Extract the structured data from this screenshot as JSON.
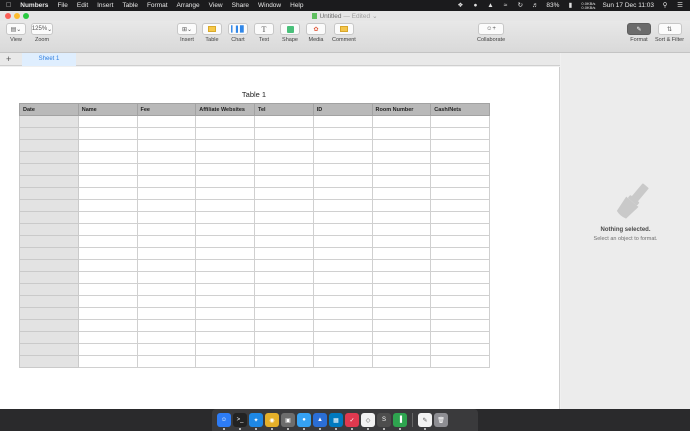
{
  "menubar": {
    "app_name": "Numbers",
    "items": [
      "File",
      "Edit",
      "Insert",
      "Table",
      "Format",
      "Arrange",
      "View",
      "Share",
      "Window",
      "Help"
    ],
    "battery": "83%",
    "net_up": "0.0KB/s",
    "net_down": "0.0KB/s",
    "datetime": "Sun 17 Dec  11:03"
  },
  "window": {
    "title": "Untitled",
    "title_status": " — Edited",
    "colors": {
      "close": "#fc5f57",
      "minimize": "#fdbc2e",
      "zoom": "#28c940"
    }
  },
  "toolbar": {
    "view_label": "View",
    "zoom_value": "125%",
    "zoom_label": "Zoom",
    "insert_label": "Insert",
    "table_label": "Table",
    "chart_label": "Chart",
    "text_label": "Text",
    "shape_label": "Shape",
    "media_label": "Media",
    "comment_label": "Comment",
    "collaborate_label": "Collaborate",
    "format_label": "Format",
    "sort_filter_label": "Sort & Filter"
  },
  "sheets": {
    "active": "Sheet 1"
  },
  "table": {
    "title": "Table 1",
    "columns": [
      "Date",
      "Name",
      "Fee",
      "Affiliate Websites",
      "Tel",
      "ID",
      "Room Number",
      "Cash/Nets"
    ],
    "row_count": 21
  },
  "inspector": {
    "title": "Nothing selected.",
    "subtitle": "Select an object to format."
  },
  "dock": {
    "apps": [
      {
        "icon": "finder-icon",
        "color": "#2d7cf6"
      },
      {
        "icon": "terminal-icon",
        "color": "#222222"
      },
      {
        "icon": "safari-icon",
        "color": "#1e88e5"
      },
      {
        "icon": "chrome-icon",
        "color": "#e5b02a"
      },
      {
        "icon": "photos-icon",
        "color": "#6d6d6d"
      },
      {
        "icon": "messages-icon",
        "color": "#35a2f4"
      },
      {
        "icon": "keynote-icon",
        "color": "#2b6ed6"
      },
      {
        "icon": "trello-icon",
        "color": "#0079bf"
      },
      {
        "icon": "pocket-icon",
        "color": "#e0394f"
      },
      {
        "icon": "sketch-icon",
        "color": "#f2f2f2"
      },
      {
        "icon": "sublime-icon",
        "color": "#4d4d4d"
      },
      {
        "icon": "numbers-icon",
        "color": "#2ea44f"
      },
      {
        "icon": "textedit-icon",
        "color": "#f3f3f3"
      }
    ]
  }
}
